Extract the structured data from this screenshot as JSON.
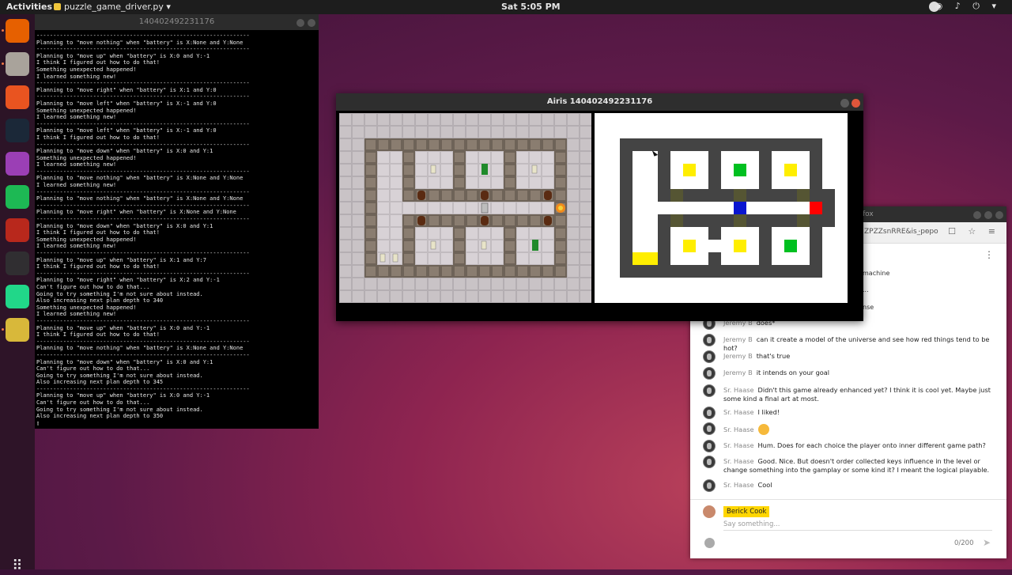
{
  "topbar": {
    "activities": "Activities",
    "app_menu": "puzzle_game_driver.py ▾",
    "clock": "Sat  5:05 PM",
    "tray_icons": [
      "steam-icon",
      "wifi-icon",
      "volume-icon",
      "power-icon"
    ],
    "tray_glyphs": "◉ ♪ ⏻ ▾"
  },
  "dock": {
    "apps": [
      {
        "name": "firefox-icon",
        "color": "#e66000"
      },
      {
        "name": "files-icon",
        "color": "#a9a39b"
      },
      {
        "name": "software-icon",
        "color": "#e95420"
      },
      {
        "name": "steam-icon",
        "color": "#1b2838"
      },
      {
        "name": "screenshot-icon",
        "color": "#9b3fb5"
      },
      {
        "name": "spotify-icon",
        "color": "#1db954"
      },
      {
        "name": "xterm-icon",
        "color": "#b8281c"
      },
      {
        "name": "obs-icon",
        "color": "#302e31"
      },
      {
        "name": "pycharm-icon",
        "color": "#21d789"
      },
      {
        "name": "python-icon",
        "color": "#d8b83a"
      }
    ],
    "grid_glyph": "⠿"
  },
  "terminal": {
    "title": "140402492231176",
    "lines": [
      "----------------------------------------------------------------",
      "Planning to \"move nothing\" when \"battery\" is X:None and Y:None",
      "----------------------------------------------------------------",
      "Planning to \"move up\" when \"battery\" is X:0 and Y:-1",
      "I think I figured out how to do that!",
      "Something unexpected happened!",
      "I learned something new!",
      "----------------------------------------------------------------",
      "Planning to \"move right\" when \"battery\" is X:1 and Y:0",
      "----------------------------------------------------------------",
      "Planning to \"move left\" when \"battery\" is X:-1 and Y:0",
      "Something unexpected happened!",
      "I learned something new!",
      "----------------------------------------------------------------",
      "Planning to \"move left\" when \"battery\" is X:-1 and Y:0",
      "I think I figured out how to do that!",
      "----------------------------------------------------------------",
      "Planning to \"move down\" when \"battery\" is X:0 and Y:1",
      "Something unexpected happened!",
      "I learned something new!",
      "----------------------------------------------------------------",
      "Planning to \"move nothing\" when \"battery\" is X:None and Y:None",
      "I learned something new!",
      "----------------------------------------------------------------",
      "Planning to \"move nothing\" when \"battery\" is X:None and Y:None",
      "----------------------------------------------------------------",
      "Planning to \"move right\" when \"battery\" is X:None and Y:None",
      "----------------------------------------------------------------",
      "Planning to \"move down\" when \"battery\" is X:0 and Y:1",
      "I think I figured out how to do that!",
      "Something unexpected happened!",
      "I learned something new!",
      "----------------------------------------------------------------",
      "Planning to \"move up\" when \"battery\" is X:1 and Y:7",
      "I think I figured out how to do that!",
      "----------------------------------------------------------------",
      "Planning to \"move right\" when \"battery\" is X:2 and Y:-1",
      "Can't figure out how to do that...",
      "Going to try something I'm not sure about instead.",
      "Also increasing next plan depth to 340",
      "Something unexpected happened!",
      "I learned something new!",
      "----------------------------------------------------------------",
      "Planning to \"move up\" when \"battery\" is X:0 and Y:-1",
      "I think I figured out how to do that!",
      "----------------------------------------------------------------",
      "Planning to \"move nothing\" when \"battery\" is X:None and Y:None",
      "----------------------------------------------------------------",
      "Planning to \"move down\" when \"battery\" is X:0 and Y:1",
      "Can't figure out how to do that...",
      "Going to try something I'm not sure about instead.",
      "Also increasing next plan depth to 345",
      "----------------------------------------------------------------",
      "Planning to \"move up\" when \"battery\" is X:0 and Y:-1",
      "Can't figure out how to do that...",
      "Going to try something I'm not sure about instead.",
      "Also increasing next plan depth to 350",
      "▯"
    ]
  },
  "airis": {
    "title": "Airis 140402492231176"
  },
  "browser": {
    "title_fragment": "fox",
    "url_fragment": "ZPZZsnRRE&is_popo",
    "toolbar_glyphs": "··· ☐ ☆ ≡",
    "kebab": "⋮",
    "partial_lines": [
      "machine",
      "...",
      "nse"
    ],
    "messages": [
      {
        "who": "Jeremy B",
        "text": "does*"
      },
      {
        "who": "Jeremy B",
        "text": "can it create a model of the universe and see how red things tend to be hot?"
      },
      {
        "who": "Jeremy B",
        "text": "that's true"
      },
      {
        "who": "Jeremy B",
        "text": "it intends on your goal"
      },
      {
        "who": "Sr. Haase",
        "text": "Didn't this game already enhanced yet? I think it is cool yet. Maybe just some kind a final art at most."
      },
      {
        "who": "Sr. Haase",
        "text": "I liked!"
      },
      {
        "who": "Sr. Haase",
        "text": ""
      },
      {
        "who": "Sr. Haase",
        "text": "Hum. Does for each choice the player onto inner different game path?"
      },
      {
        "who": "Sr. Haase",
        "text": "Good. Nice. But doesn't order collected keys influence in the level or change something into the gamplay or some kind it? I meant the logical playable."
      },
      {
        "who": "Sr. Haase",
        "text": "Cool"
      }
    ],
    "me_name": "Berick Cook",
    "say_placeholder": "Say something...",
    "char_count": "0/200",
    "send_glyph": "➤"
  }
}
